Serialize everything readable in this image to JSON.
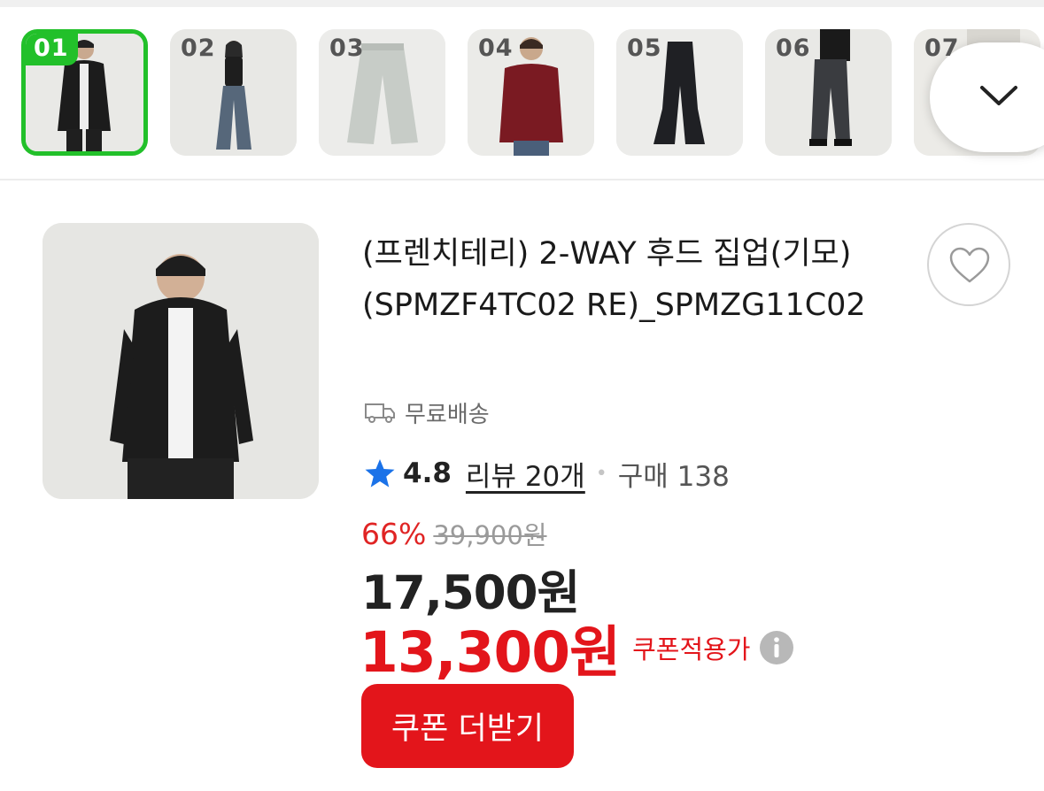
{
  "thumbnails": [
    {
      "num": "01",
      "selected": true
    },
    {
      "num": "02",
      "selected": false
    },
    {
      "num": "03",
      "selected": false
    },
    {
      "num": "04",
      "selected": false
    },
    {
      "num": "05",
      "selected": false
    },
    {
      "num": "06",
      "selected": false
    },
    {
      "num": "07",
      "selected": false
    }
  ],
  "product": {
    "title": "(프렌치테리) 2-WAY 후드 집업(기모) (SPMZF4TC02 RE)_SPMZG11C02",
    "shipping": "무료배송",
    "rating": "4.8",
    "reviews": "리뷰 20개",
    "purchases": "구매 138",
    "discount_rate": "66%",
    "original_price": "39,900원",
    "sale_price": "17,500원",
    "coupon_price": "13,300원",
    "coupon_label": "쿠폰적용가",
    "coupon_button": "쿠폰 더받기"
  },
  "colors": {
    "selected_thumb": "#22c02a",
    "price_red": "#e3151b",
    "star_blue": "#1b72e8"
  },
  "icons": [
    "chevron-down-icon",
    "heart-icon",
    "truck-icon",
    "star-icon",
    "info-icon"
  ]
}
